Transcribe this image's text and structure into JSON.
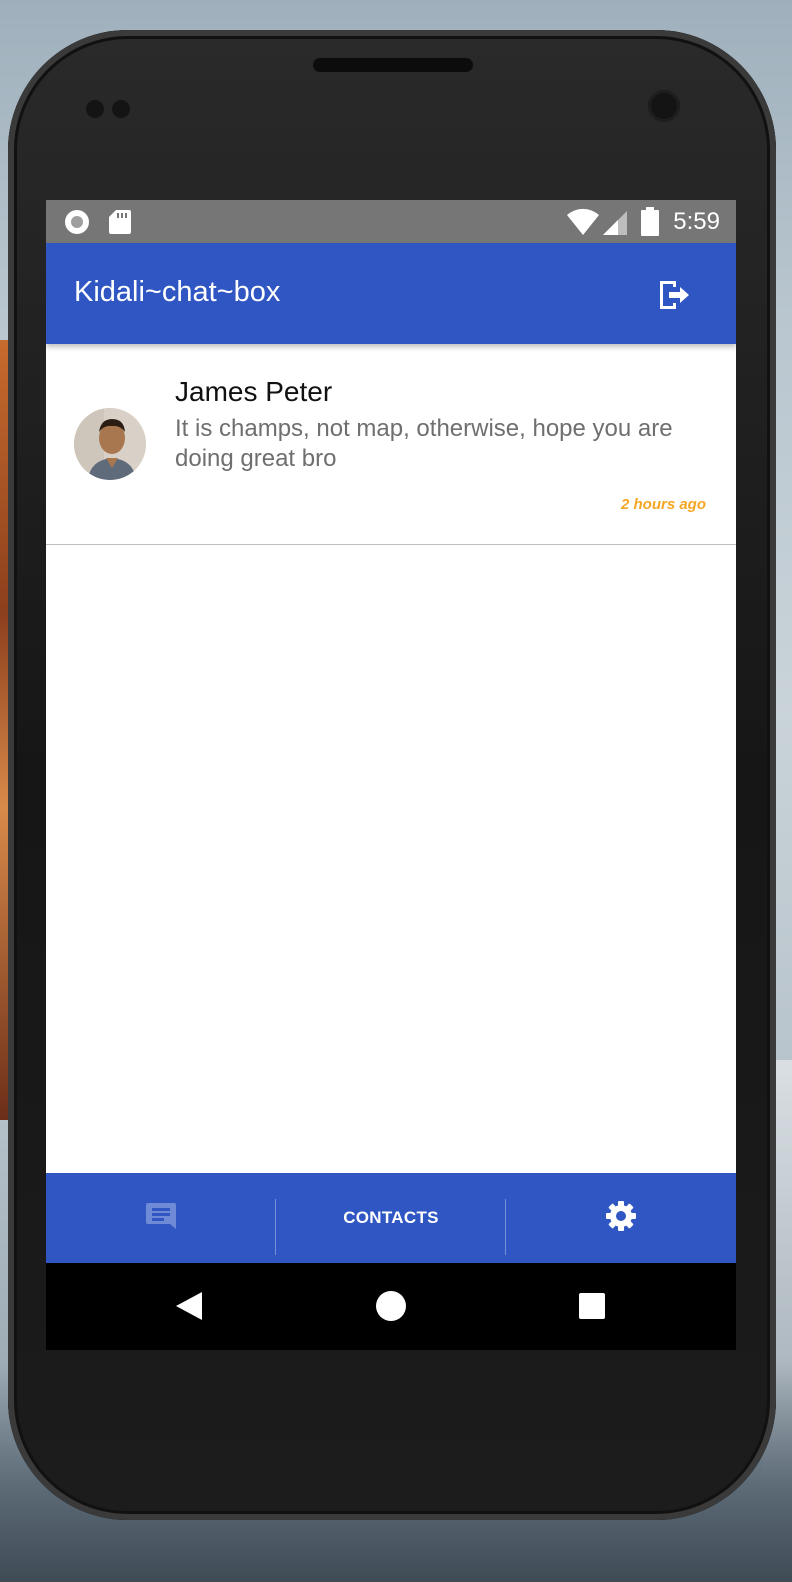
{
  "status_bar": {
    "time": "5:59",
    "icons": [
      "record-icon",
      "sd-card-icon",
      "wifi-icon",
      "cell-signal-icon",
      "battery-icon"
    ]
  },
  "app_bar": {
    "title": "Kidali~chat~box",
    "logout_icon": "logout-icon"
  },
  "chats": [
    {
      "name": "James Peter",
      "message": "It is champs, not map, otherwise, hope you are doing great bro",
      "time": "2 hours ago",
      "avatar": "avatar-photo"
    }
  ],
  "bottom_nav": {
    "tabs": [
      {
        "icon": "chat-icon",
        "label": ""
      },
      {
        "icon": "",
        "label": "CONTACTS"
      },
      {
        "icon": "settings-icon",
        "label": ""
      }
    ]
  },
  "system_nav": {
    "icons": [
      "back-icon",
      "home-icon",
      "recents-icon"
    ]
  },
  "colors": {
    "primary": "#2f56c2",
    "status_bar": "#767676",
    "timestamp": "#f5a623",
    "message_text": "#6f6f6f"
  }
}
